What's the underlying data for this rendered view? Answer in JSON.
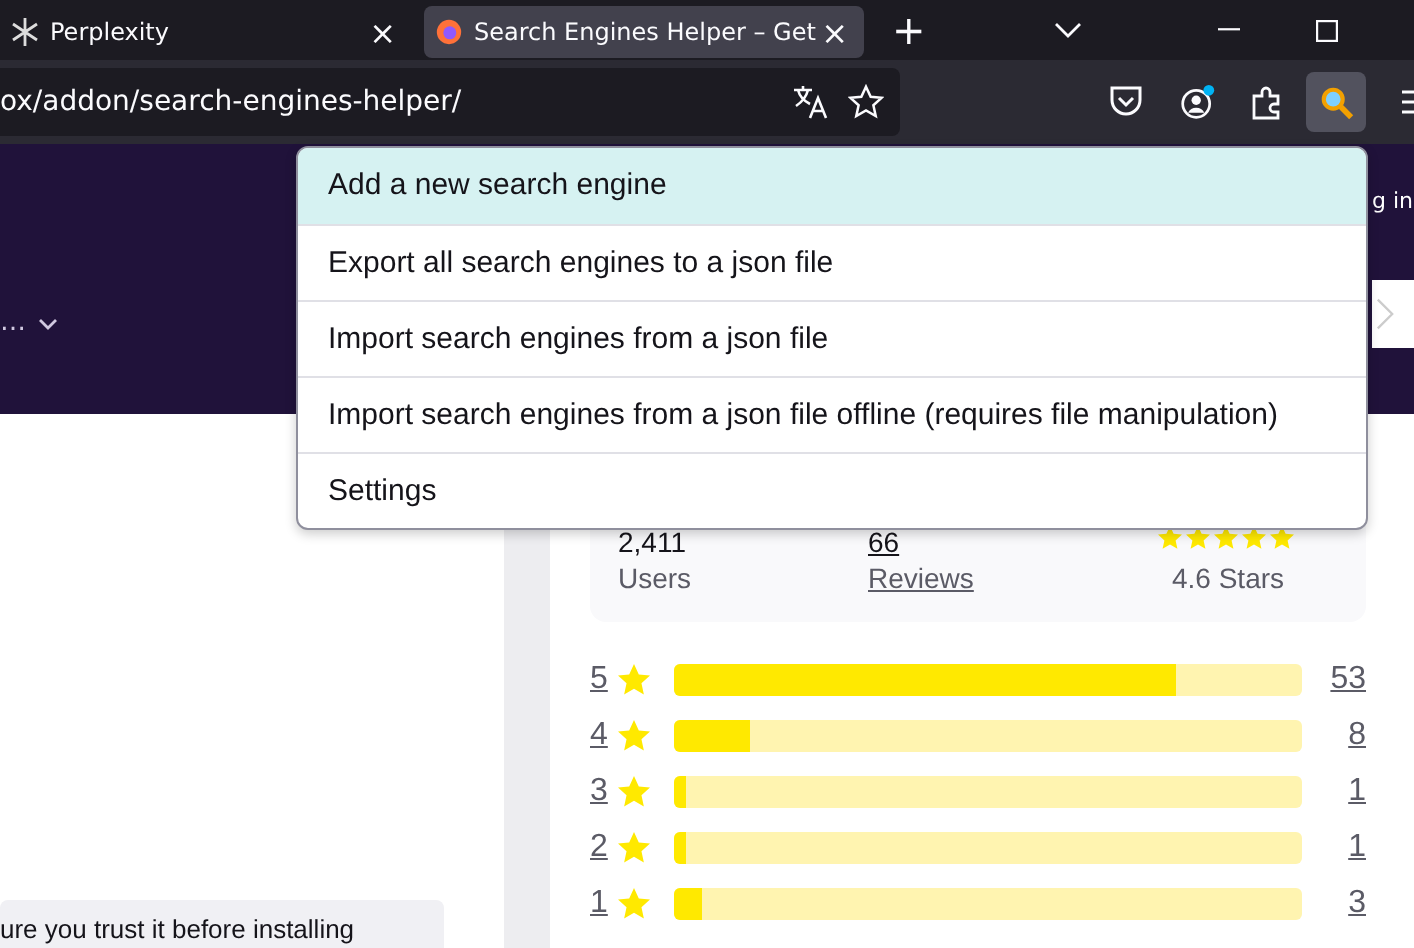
{
  "tabs": [
    {
      "title": "Perplexity",
      "close": "×",
      "selected": false
    },
    {
      "title": "Search Engines Helper – Get",
      "close": "×",
      "selected": true
    }
  ],
  "new_tab": "+",
  "address_bar": {
    "url": "ox/addon/search-engines-helper/"
  },
  "hero": {
    "side_text": "g in",
    "menu_label": "…"
  },
  "menu": {
    "items": [
      {
        "label": "Add a new search engine",
        "selected": true
      },
      {
        "label": "Export all search engines to a json file",
        "selected": false
      },
      {
        "label": "Import search engines from a json file",
        "selected": false
      },
      {
        "label": "Import search engines from a json file offline (requires file manipulation)",
        "selected": false
      },
      {
        "label": "Settings",
        "selected": false
      }
    ]
  },
  "stats": {
    "users": "2,411",
    "users_label": "Users",
    "reviews": "66",
    "reviews_label": "Reviews",
    "rating_label": "4.6 Stars"
  },
  "ratings": [
    {
      "stars": "5",
      "count": "53",
      "level": 0.8
    },
    {
      "stars": "4",
      "count": "8",
      "level": 0.12
    },
    {
      "stars": "3",
      "count": "1",
      "level": 0.02
    },
    {
      "stars": "2",
      "count": "1",
      "level": 0.02
    },
    {
      "stars": "1",
      "count": "3",
      "level": 0.045
    }
  ],
  "notice": "ure you trust it before installing"
}
